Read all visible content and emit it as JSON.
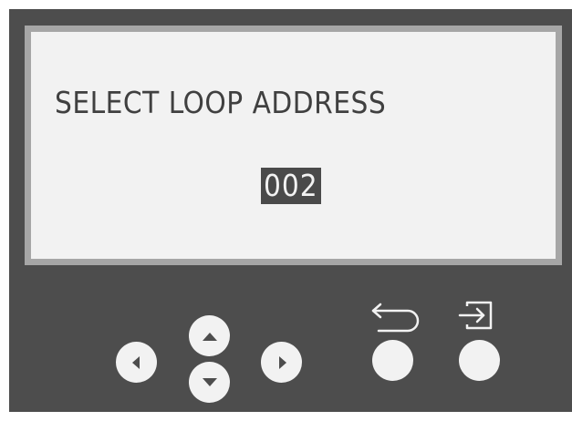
{
  "display": {
    "title": "SELECT LOOP ADDRESS",
    "value": "002"
  },
  "controls": {
    "left": "left-arrow-icon",
    "up": "up-arrow-icon",
    "down": "down-arrow-icon",
    "right": "right-arrow-icon",
    "back": "back-arrow-icon",
    "enter": "enter-icon"
  },
  "colors": {
    "panel": "#4d4d4d",
    "screen": "#f2f2f2",
    "screen_border": "#a6a6a6",
    "text": "#404040",
    "highlight": "#4a4a4a"
  }
}
